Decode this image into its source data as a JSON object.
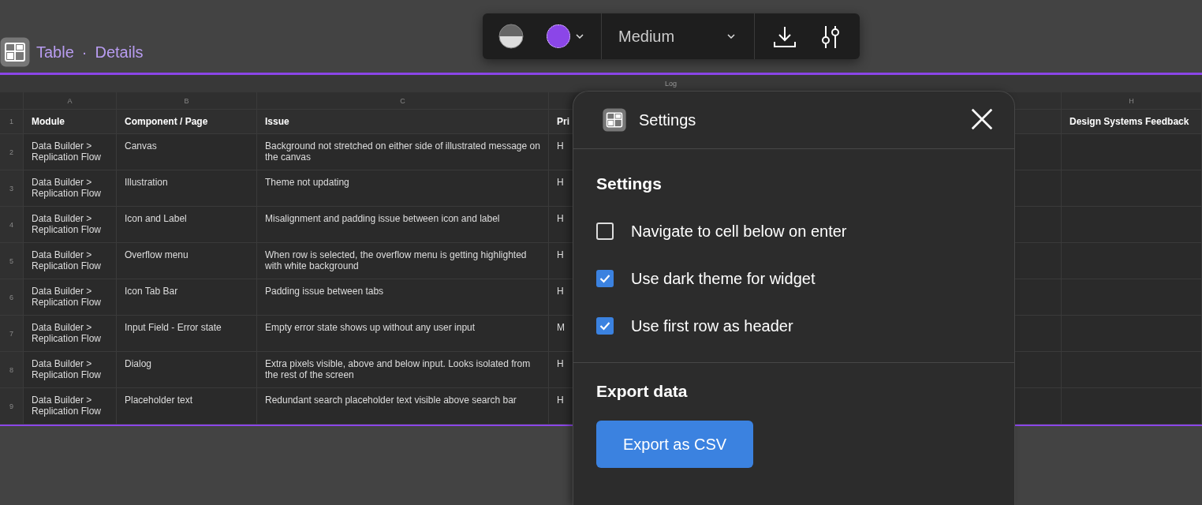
{
  "header": {
    "title": "Table",
    "separator": "·",
    "subtitle": "Details"
  },
  "toolbar": {
    "swatch": {
      "color": "#8b46e8"
    },
    "size": {
      "value": "Medium"
    }
  },
  "table": {
    "caption": "Log",
    "columns": [
      {
        "letter": "A",
        "header": "Module"
      },
      {
        "letter": "B",
        "header": "Component / Page"
      },
      {
        "letter": "C",
        "header": "Issue"
      },
      {
        "header": "Pri"
      },
      {},
      {},
      {},
      {
        "letter": "H",
        "header": "Design Systems Feedback"
      }
    ],
    "header_row_number": "1",
    "rows": [
      {
        "number": "2",
        "cells": [
          "Data Builder > Replication Flow",
          "Canvas",
          "Background not stretched on either side of illustrated message on the canvas",
          "H"
        ]
      },
      {
        "number": "3",
        "cells": [
          "Data Builder > Replication Flow",
          "Illustration",
          "Theme not updating",
          "H"
        ]
      },
      {
        "number": "4",
        "cells": [
          "Data Builder > Replication Flow",
          "Icon and Label",
          "Misalignment and padding issue between icon and label",
          "H"
        ]
      },
      {
        "number": "5",
        "cells": [
          "Data Builder > Replication Flow",
          "Overflow menu",
          "When row is selected, the overflow menu is getting highlighted with white background",
          "H"
        ]
      },
      {
        "number": "6",
        "cells": [
          "Data Builder > Replication Flow",
          "Icon Tab Bar",
          "Padding issue between tabs",
          "H"
        ]
      },
      {
        "number": "7",
        "cells": [
          "Data Builder > Replication Flow",
          "Input Field - Error state",
          "Empty error state shows up without any user input",
          "M"
        ]
      },
      {
        "number": "8",
        "cells": [
          "Data Builder > Replication Flow",
          "Dialog",
          "Extra pixels visible, above and below input. Looks isolated from the rest of the screen",
          "H"
        ]
      },
      {
        "number": "9",
        "cells": [
          "Data Builder > Replication Flow",
          "Placeholder text",
          "Redundant search placeholder text visible above search bar",
          "H"
        ]
      }
    ]
  },
  "dialog": {
    "title": "Settings",
    "sections": [
      {
        "heading": "Settings",
        "options": [
          {
            "label": "Navigate to cell below on enter",
            "checked": false
          },
          {
            "label": "Use dark theme for widget",
            "checked": true
          },
          {
            "label": "Use first row as header",
            "checked": true
          }
        ]
      },
      {
        "heading": "Export data",
        "button": "Export as CSV"
      }
    ]
  }
}
